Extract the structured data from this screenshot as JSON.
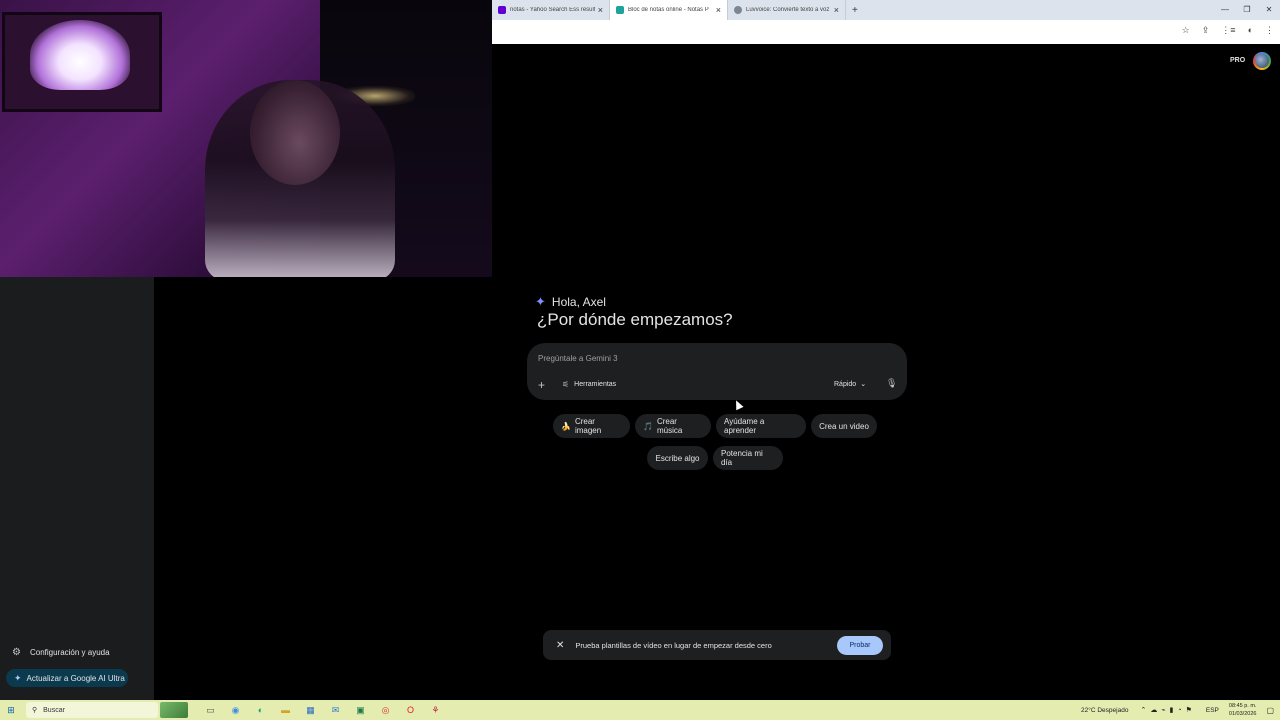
{
  "browser": {
    "tabs": [
      {
        "title": "notas - Yahoo Search Ess resulti",
        "color": "#6001d2",
        "active": false
      },
      {
        "title": "Bloc de notas online - Notas P",
        "color": "#1ba39c",
        "active": true
      },
      {
        "title": "Luvvoice: Convierte texto a voz",
        "color": "#7d8794",
        "active": false
      }
    ],
    "new_tab": "+",
    "window_controls": [
      "—",
      "❐",
      "✕"
    ],
    "address_icons": [
      "☆",
      "⇪",
      "⋮≡",
      "◐",
      "⋮"
    ]
  },
  "sidebar": {
    "settings_label": "Configuración y ayuda",
    "upgrade_label": "Actualizar a Google AI Ultra"
  },
  "header": {
    "plan_badge": "PRO"
  },
  "main": {
    "greeting": "Hola, Axel",
    "headline": "¿Por dónde empezamos?",
    "prompt_placeholder": "Pregúntale a Gemini 3",
    "tools_label": "Herramientas",
    "mode_label": "Rápido"
  },
  "chips": [
    {
      "label": "Crear imagen",
      "emoji": "🍌"
    },
    {
      "label": "Crear música",
      "emoji": "🎵"
    },
    {
      "label": "Ayúdame a aprender",
      "emoji": ""
    },
    {
      "label": "Crea un video",
      "emoji": ""
    },
    {
      "label": "Escribe algo",
      "emoji": ""
    },
    {
      "label": "Potencia mi día",
      "emoji": ""
    }
  ],
  "banner": {
    "message": "Prueba plantillas de vídeo en lugar de empezar desde cero",
    "button": "Probar"
  },
  "taskbar": {
    "search_placeholder": "Buscar",
    "weather": "22°C Despejado",
    "language": "ESP",
    "time": "08:45 p. m.",
    "date": "01/03/2026"
  }
}
